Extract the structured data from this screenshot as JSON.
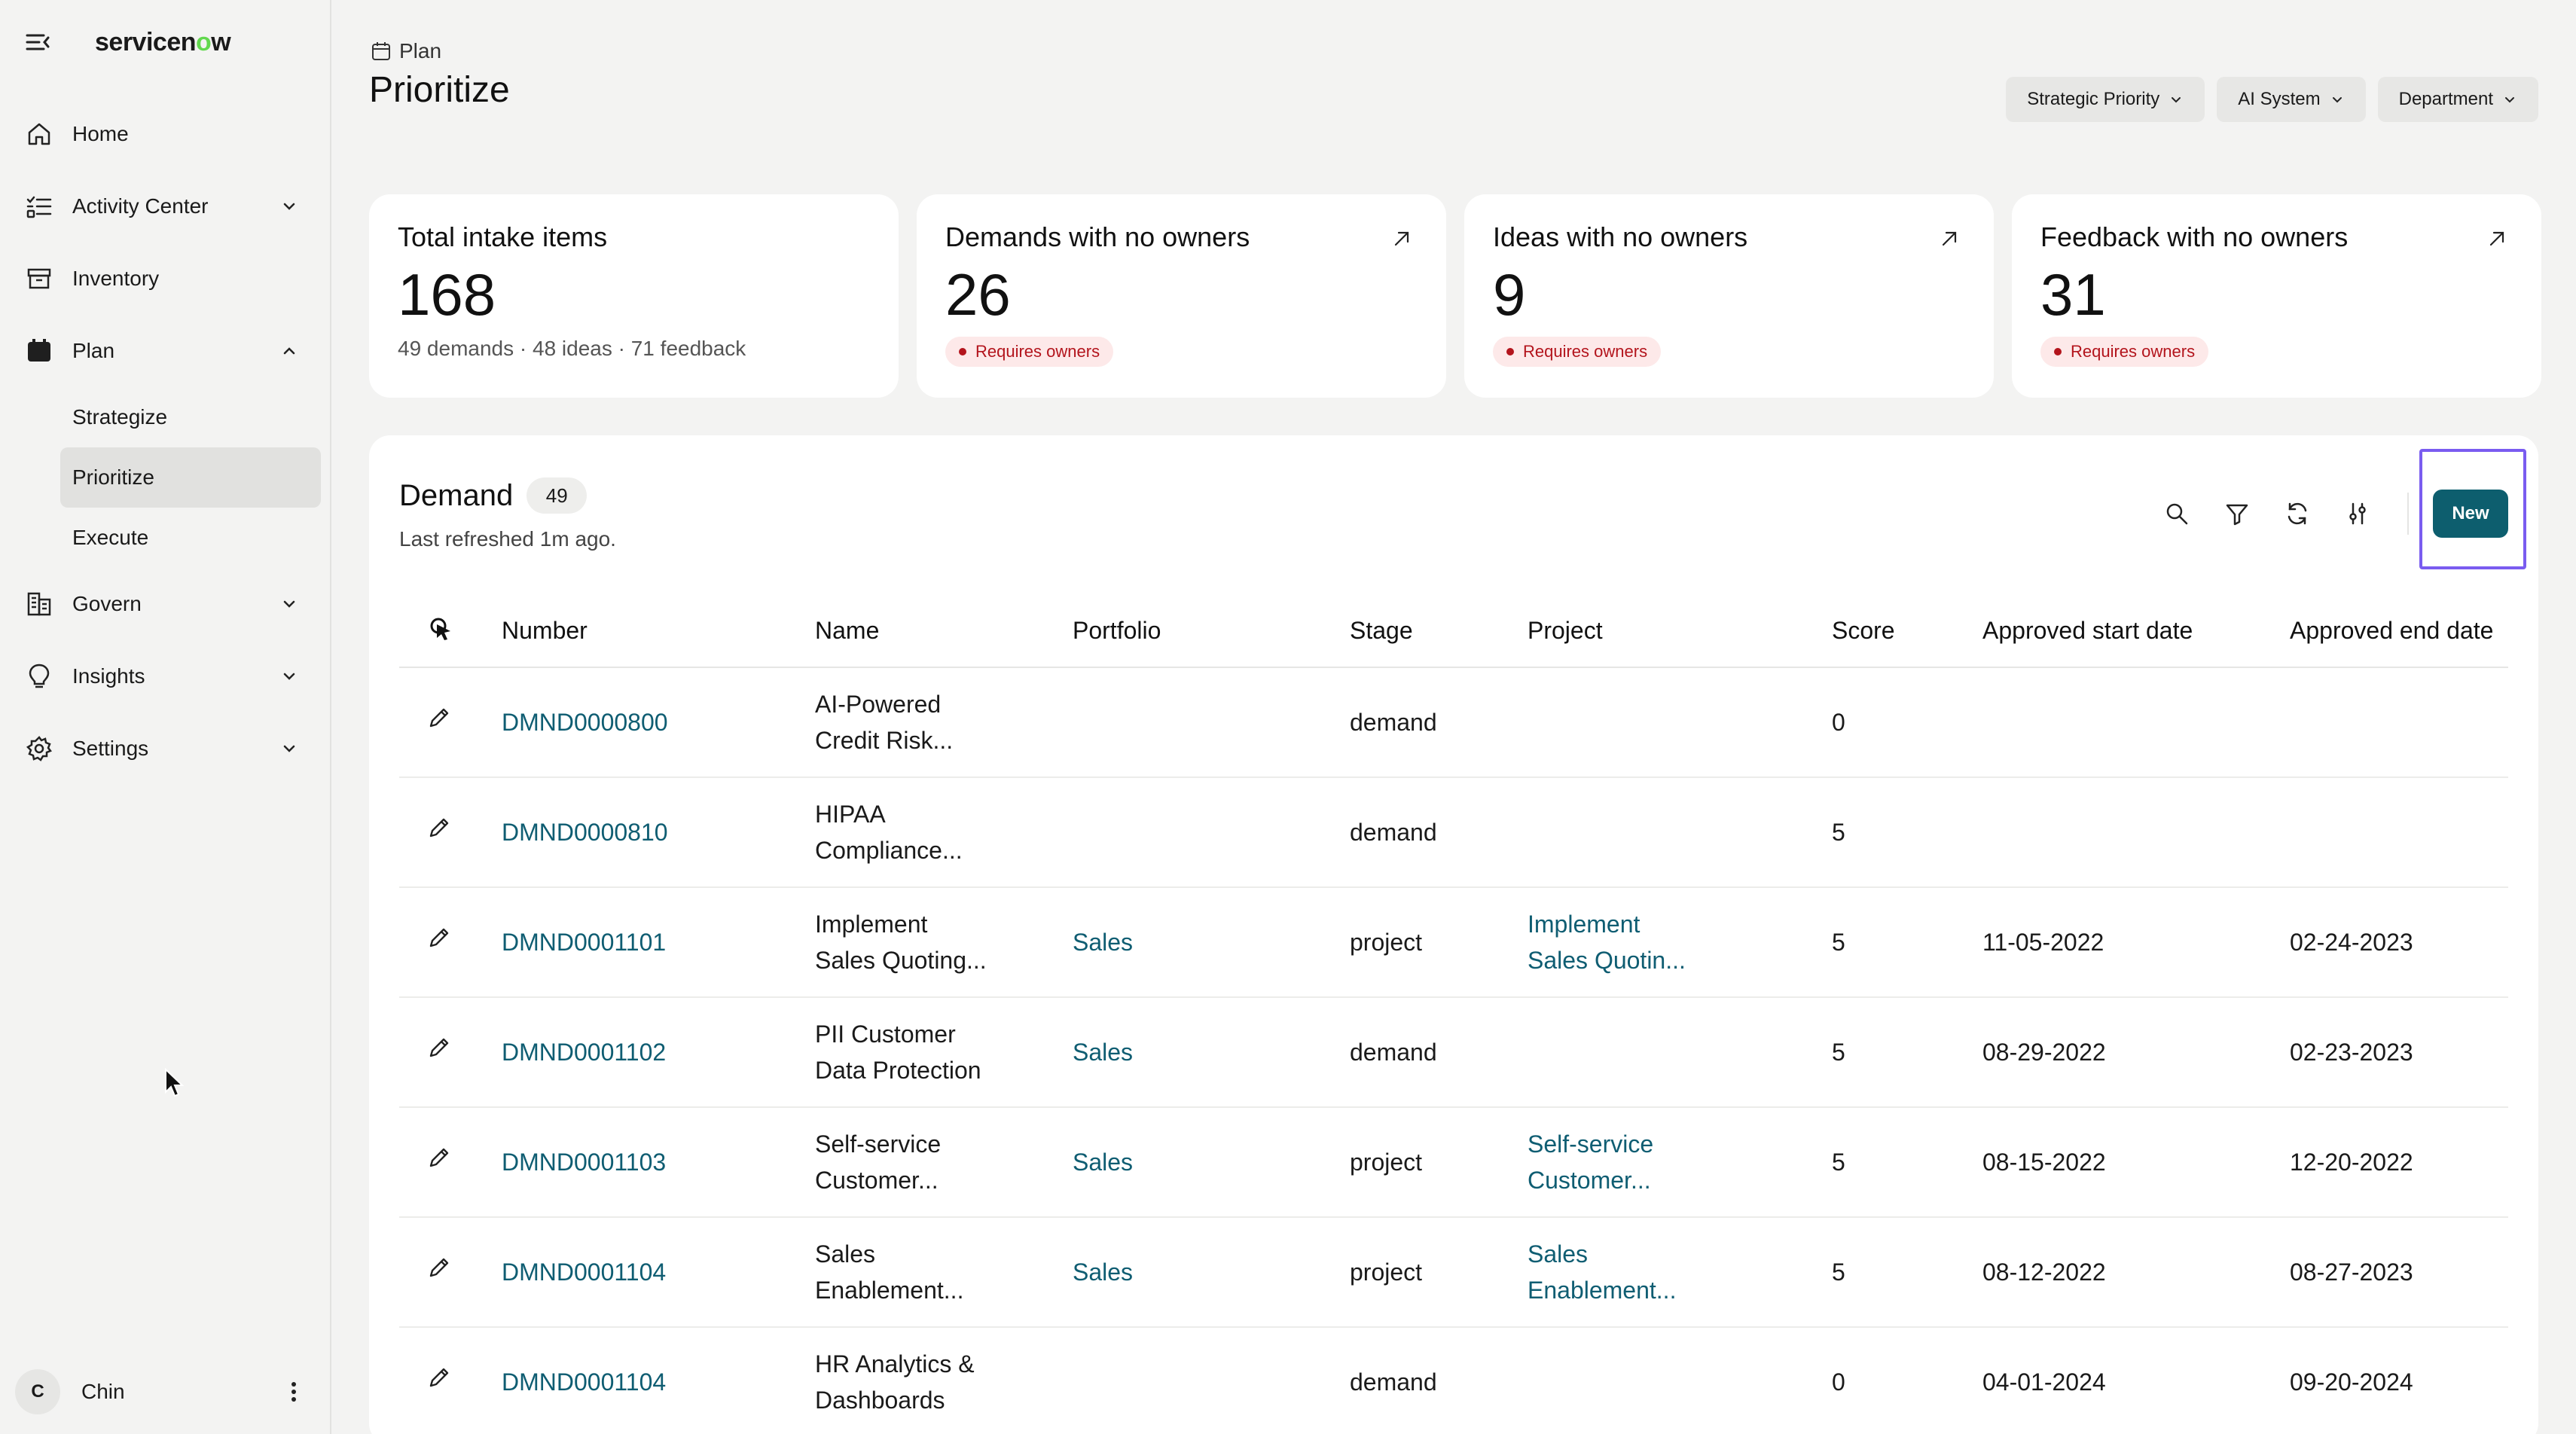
{
  "app": {
    "brand_prefix": "servicen",
    "brand_o": "o",
    "brand_suffix": "w"
  },
  "sidebar": {
    "items": [
      {
        "label": "Home",
        "icon": "home-icon"
      },
      {
        "label": "Activity Center",
        "icon": "activity-icon",
        "expandable": true
      },
      {
        "label": "Inventory",
        "icon": "inventory-icon"
      },
      {
        "label": "Plan",
        "icon": "plan-icon",
        "expanded": true,
        "children": [
          {
            "label": "Strategize"
          },
          {
            "label": "Prioritize",
            "active": true
          },
          {
            "label": "Execute"
          }
        ]
      },
      {
        "label": "Govern",
        "icon": "govern-icon",
        "expandable": true
      },
      {
        "label": "Insights",
        "icon": "lightbulb-icon",
        "expandable": true
      },
      {
        "label": "Settings",
        "icon": "gear-icon",
        "expandable": true
      }
    ],
    "user": {
      "initial": "C",
      "name": "Chin"
    }
  },
  "header": {
    "breadcrumb": "Plan",
    "title": "Prioritize",
    "filters": [
      "Strategic Priority",
      "AI System",
      "Department"
    ]
  },
  "cards": [
    {
      "title": "Total intake items",
      "value": "168",
      "sub": "49 demands · 48 ideas · 71 feedback"
    },
    {
      "title": "Demands with no owners",
      "value": "26",
      "badge": "Requires owners"
    },
    {
      "title": "Ideas with no owners",
      "value": "9",
      "badge": "Requires owners"
    },
    {
      "title": "Feedback with no owners",
      "value": "31",
      "badge": "Requires owners"
    }
  ],
  "panel": {
    "title": "Demand",
    "count": "49",
    "refreshed": "Last refreshed 1m ago.",
    "new_label": "New",
    "columns": [
      "Number",
      "Name",
      "Portfolio",
      "Stage",
      "Project",
      "Score",
      "Approved start date",
      "Approved end date"
    ],
    "rows": [
      {
        "number": "DMND0000800",
        "name1": "AI-Powered",
        "name2": "Credit Risk...",
        "portfolio": "",
        "stage": "demand",
        "project1": "",
        "project2": "",
        "score": "0",
        "start": "",
        "end": ""
      },
      {
        "number": "DMND0000810",
        "name1": "HIPAA",
        "name2": "Compliance...",
        "portfolio": "",
        "stage": "demand",
        "project1": "",
        "project2": "",
        "score": "5",
        "start": "",
        "end": ""
      },
      {
        "number": "DMND0001101",
        "name1": "Implement",
        "name2": "Sales Quoting...",
        "portfolio": "Sales",
        "stage": "project",
        "project1": "Implement",
        "project2": "Sales Quotin...",
        "score": "5",
        "start": "11-05-2022",
        "end": "02-24-2023"
      },
      {
        "number": "DMND0001102",
        "name1": "PII Customer",
        "name2": "Data Protection",
        "portfolio": "Sales",
        "stage": "demand",
        "project1": "",
        "project2": "",
        "score": "5",
        "start": "08-29-2022",
        "end": "02-23-2023"
      },
      {
        "number": "DMND0001103",
        "name1": "Self-service",
        "name2": "Customer...",
        "portfolio": "Sales",
        "stage": "project",
        "project1": "Self-service",
        "project2": "Customer...",
        "score": "5",
        "start": "08-15-2022",
        "end": "12-20-2022"
      },
      {
        "number": "DMND0001104",
        "name1": "Sales",
        "name2": "Enablement...",
        "portfolio": "Sales",
        "stage": "project",
        "project1": "Sales",
        "project2": "Enablement...",
        "score": "5",
        "start": "08-12-2022",
        "end": "08-27-2023"
      },
      {
        "number": "DMND0001104",
        "name1": "HR Analytics &",
        "name2": "Dashboards",
        "portfolio": "",
        "stage": "demand",
        "project1": "",
        "project2": "",
        "score": "0",
        "start": "04-01-2024",
        "end": "09-20-2024"
      }
    ]
  },
  "colors": {
    "accent": "#0d5e6e",
    "link": "#0f5d72",
    "highlight": "#7a5cf0",
    "badge_text": "#b3141c",
    "badge_bg": "#fde9e9"
  }
}
